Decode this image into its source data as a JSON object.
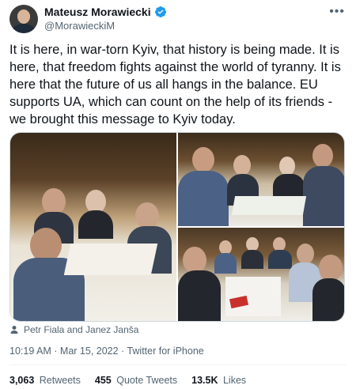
{
  "author": {
    "name": "Mateusz Morawiecki",
    "handle": "@MorawieckiM"
  },
  "tweet": {
    "text": "It is here, in war-torn Kyiv, that history is being made. It is here, that freedom fights against the world of tyranny. It is here that the future of us all hangs in the balance. EU supports UA, which can count on the help of its friends - we brought this message to Kyiv today.",
    "tagged": "Petr Fiala and Janez Janša",
    "time": "10:19 AM · Mar 15, 2022 · Twitter for iPhone"
  },
  "stats": {
    "retweets_count": "3,063",
    "retweets_label": "Retweets",
    "quotes_count": "455",
    "quotes_label": "Quote Tweets",
    "likes_count": "13.5K",
    "likes_label": "Likes"
  },
  "colors": {
    "verified": "#1d9bf0",
    "secondary_text": "#536471",
    "primary_text": "#0f1419"
  },
  "icons": {
    "verified": "verified-badge-icon",
    "more": "more-options-icon",
    "tag": "person-icon"
  }
}
